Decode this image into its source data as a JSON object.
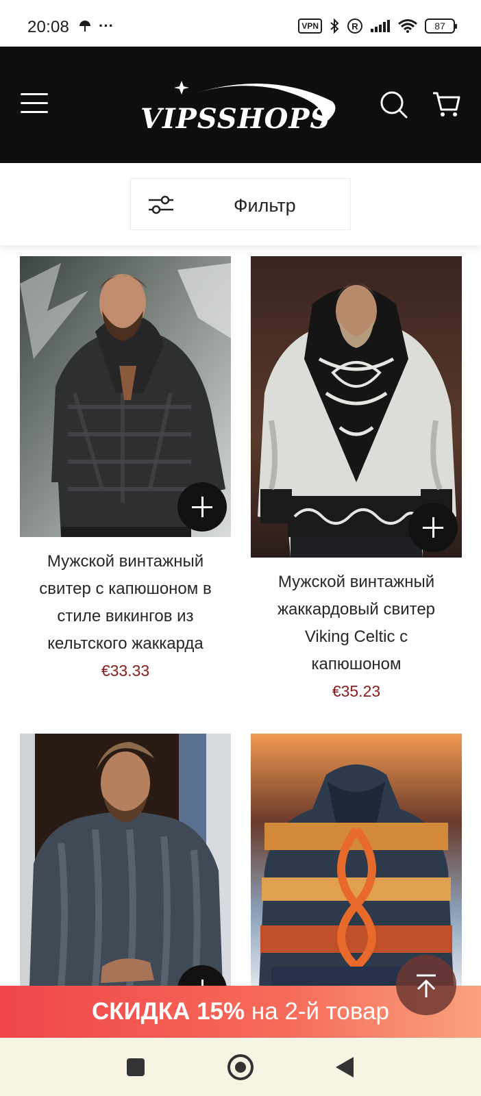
{
  "status_bar": {
    "time": "20:08",
    "more": "···",
    "vpn": "VPN",
    "battery": "87",
    "icons": [
      "umbrella-icon",
      "bluetooth-icon",
      "registered-icon",
      "signal-icon",
      "wifi-icon",
      "battery-icon"
    ]
  },
  "header": {
    "logo_text": "VIPSSHOPS",
    "icons": [
      "menu-icon",
      "search-icon",
      "cart-icon"
    ],
    "background": "#0e0e0e"
  },
  "filter": {
    "label": "Фильтр",
    "icon": "sliders-icon"
  },
  "products": [
    {
      "title": "Мужской винтажный свитер с капюшоном в стиле викингов из кельтского жаккарда",
      "price": "€33.33"
    },
    {
      "title": "Мужской винтажный жаккардовый свитер Viking Celtic с капюшоном",
      "price": "€35.23"
    },
    {
      "title": "",
      "price": ""
    },
    {
      "title": "",
      "price": ""
    }
  ],
  "promo": {
    "bold": "СКИДКА 15%",
    "rest": " на 2-й товар",
    "color_start": "#f0454a",
    "color_end": "#f8a27e"
  },
  "price_color": "#8d1a1a"
}
